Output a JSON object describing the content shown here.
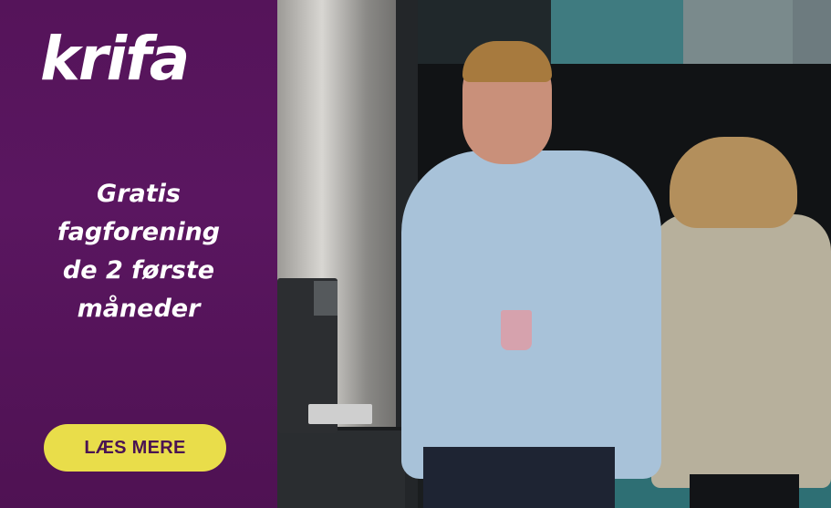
{
  "brand": {
    "logo_text": "krifa"
  },
  "headline": {
    "lines": [
      "Gratis",
      "fagforening",
      "de 2 første",
      "måneder"
    ]
  },
  "cta": {
    "label": "LÆS MERE"
  },
  "colors": {
    "panel": "#55145a",
    "cta_background": "#e9dd4a",
    "cta_text": "#4a1352",
    "text": "#ffffff"
  }
}
